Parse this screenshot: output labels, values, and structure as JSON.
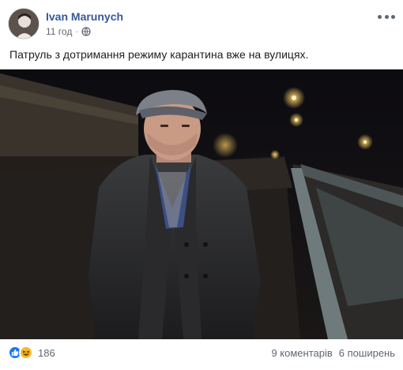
{
  "post": {
    "author": "Ivan Marunych",
    "time": "11 год",
    "separator": "·",
    "text": "Патруль з дотримання режиму карантина вже на вулицях.",
    "privacy_icon": "globe-icon",
    "menu_icon": "more-options-icon"
  },
  "footer": {
    "reaction_icons": [
      "like-icon",
      "haha-icon"
    ],
    "reaction_count": "186",
    "comments": "9 коментарів",
    "shares": "6 поширень"
  },
  "colors": {
    "author_link": "#385898",
    "meta_text": "#606770",
    "like_blue": "#1877f2",
    "haha_yellow": "#f7b928"
  }
}
